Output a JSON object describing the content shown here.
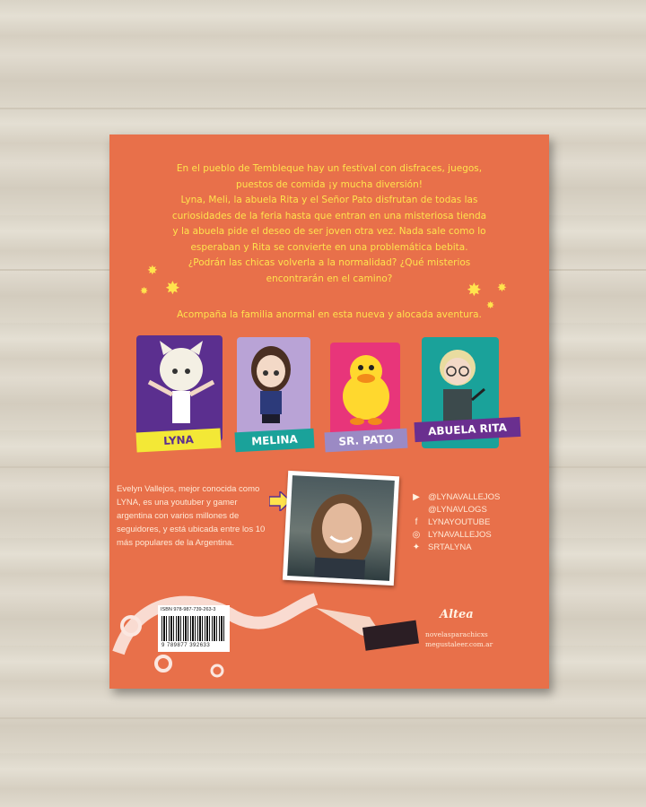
{
  "blurb": {
    "lines": [
      "En el pueblo de Tembleque hay un festival con disfraces, juegos,",
      "puestos de comida ¡y mucha diversión!",
      "Lyna, Meli, la abuela Rita y el Señor Pato disfrutan de todas las",
      "curiosidades de la feria hasta que entran en una misteriosa tienda",
      "y la abuela pide el deseo de ser joven otra vez. Nada sale como lo",
      "esperaban y Rita se convierte en una problemática bebita.",
      "¿Podrán las chicas volverla a la normalidad? ¿Qué misterios",
      "encontrarán en el camino?"
    ],
    "tagline": "Acompaña la familia anormal en esta nueva y alocada aventura."
  },
  "characters": [
    {
      "label": "LYNA",
      "card_color": "#5b2f8f",
      "label_bg": "#f3e836",
      "label_color": "#5b2f8f"
    },
    {
      "label": "MELINA",
      "card_color": "#b9a3d6",
      "label_bg": "#1aa29a",
      "label_color": "#ffffff"
    },
    {
      "label": "SR. PATO",
      "card_color": "#e8357a",
      "label_bg": "#9b8ac4",
      "label_color": "#ffffff"
    },
    {
      "label": "ABUELA RITA",
      "card_color": "#1aa29a",
      "label_bg": "#6a2f8f",
      "label_color": "#ffffff"
    }
  ],
  "author": {
    "bio": "Evelyn Vallejos, mejor conocida como LYNA, es una youtuber y gamer argentina con varios millones de seguidores, y está ubicada entre los 10 más populares de la Argentina."
  },
  "social": [
    {
      "icon": "youtube-icon",
      "glyph": "▶",
      "text": "@LYNAVALLEJOS"
    },
    {
      "icon": "",
      "glyph": "",
      "text": "@LYNAVLOGS"
    },
    {
      "icon": "facebook-icon",
      "glyph": "f",
      "text": "LYNAYOUTUBE"
    },
    {
      "icon": "instagram-icon",
      "glyph": "◎",
      "text": "LYNAVALLEJOS"
    },
    {
      "icon": "twitter-icon",
      "glyph": "✦",
      "text": "SRTALYNA"
    }
  ],
  "barcode": {
    "isbn": "ISBN 978-987-739-263-3",
    "number": "9 789877 392633"
  },
  "publisher": {
    "name": "Altea",
    "web1": "novelasparachicxs",
    "web2": "megustaleer.com.ar"
  },
  "colors": {
    "cover": "#e8704a",
    "text_yellow": "#ffe34d"
  }
}
